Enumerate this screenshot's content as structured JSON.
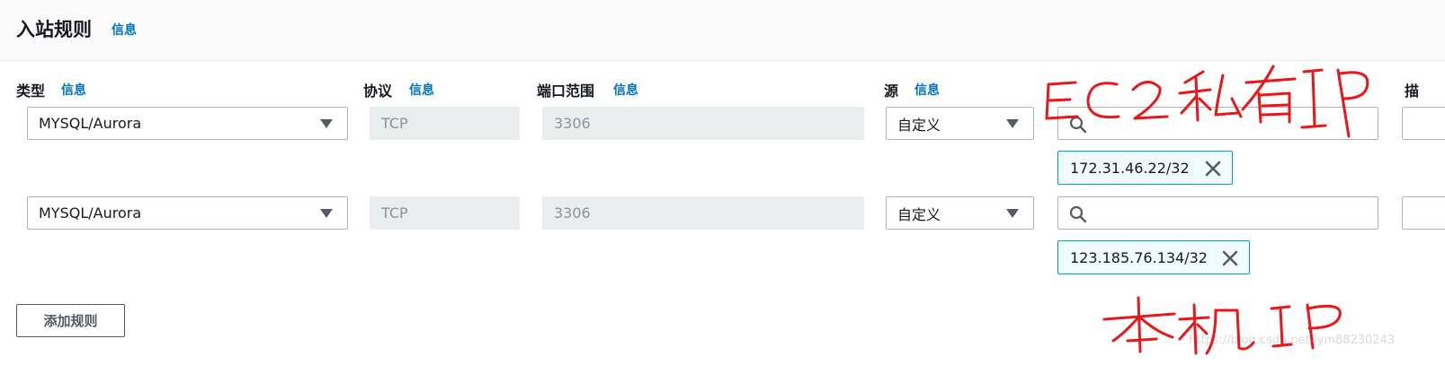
{
  "header": {
    "title": "入站规则",
    "info": "信息"
  },
  "columns": {
    "type": {
      "label": "类型",
      "info": "信息"
    },
    "protocol": {
      "label": "协议",
      "info": "信息"
    },
    "port_range": {
      "label": "端口范围",
      "info": "信息"
    },
    "source": {
      "label": "源",
      "info": "信息"
    },
    "cut_label": "描"
  },
  "rules": [
    {
      "type": "MYSQL/Aurora",
      "protocol": "TCP",
      "port": "3306",
      "source_mode": "自定义",
      "search_placeholder": "",
      "cidr": "172.31.46.22/32"
    },
    {
      "type": "MYSQL/Aurora",
      "protocol": "TCP",
      "port": "3306",
      "source_mode": "自定义",
      "search_placeholder": "",
      "cidr": "123.185.76.134/32"
    }
  ],
  "add_rule_button": "添加规则",
  "annotations": {
    "color": "#e8181a",
    "top_note": "EC2私有IP",
    "bottom_note": "本机IP"
  },
  "watermark": "https://blog.csdn.net/lym88230243",
  "icons": {
    "search": "search-icon",
    "close": "close-icon",
    "dropdown": "caret-down-icon"
  }
}
